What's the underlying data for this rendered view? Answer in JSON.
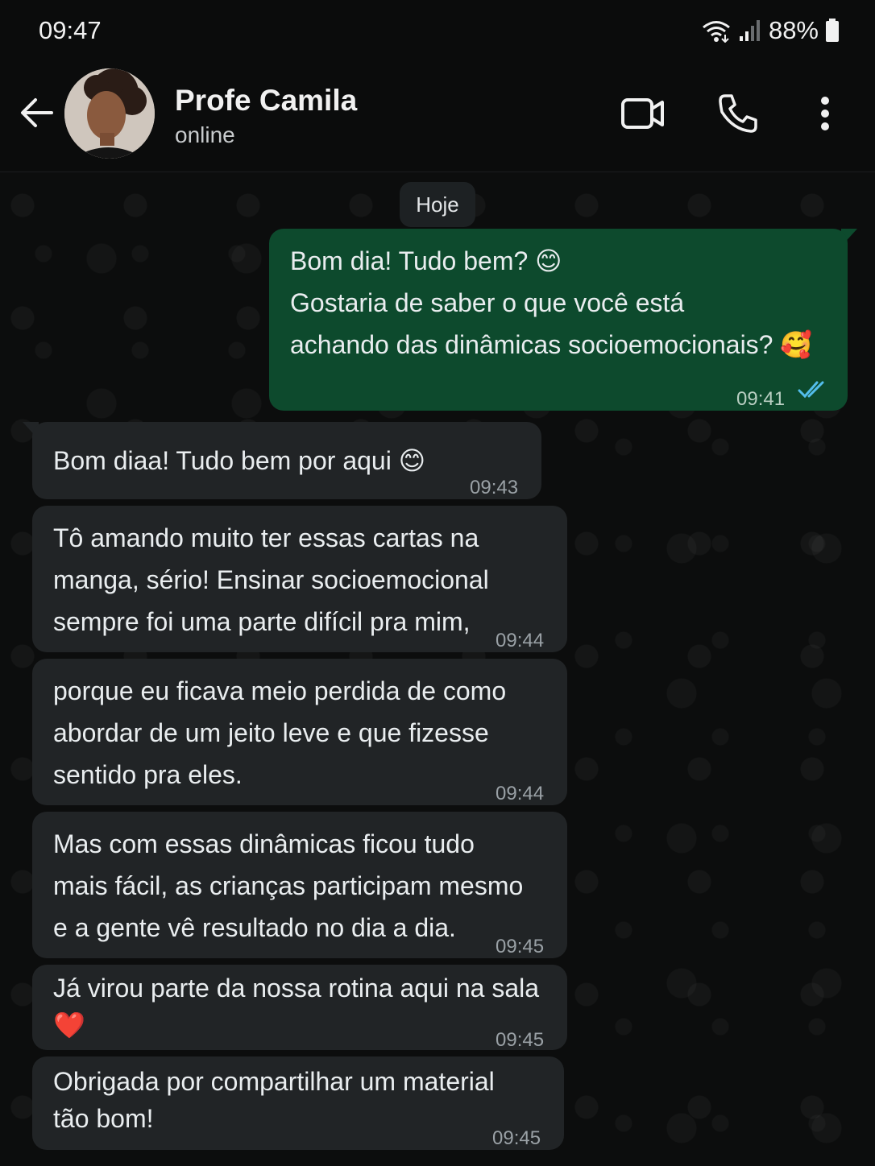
{
  "status_bar": {
    "time": "09:47",
    "battery": "88%"
  },
  "header": {
    "contact_name": "Profe Camila",
    "contact_status": "online"
  },
  "date_chip": "Hoje",
  "messages": [
    {
      "direction": "out",
      "text": "Bom dia! Tudo bem? 😊\nGostaria de saber o que você está\nachando das dinâmicas socioemocionais? 🥰",
      "time": "09:41",
      "read": true
    },
    {
      "direction": "in",
      "text": "Bom diaa! Tudo bem por aqui 😊",
      "time": "09:43"
    },
    {
      "direction": "in",
      "text": "Tô amando muito ter essas cartas na\nmanga, sério! Ensinar socioemocional\nsempre foi uma parte difícil pra mim,",
      "time": "09:44"
    },
    {
      "direction": "in",
      "text": "porque eu ficava meio perdida de como\nabordar de um jeito leve e que fizesse\nsentido pra eles.",
      "time": "09:44"
    },
    {
      "direction": "in",
      "text": "Mas com essas dinâmicas ficou tudo\nmais fácil, as crianças participam mesmo\ne a gente vê resultado no dia a dia.",
      "time": "09:45"
    },
    {
      "direction": "in",
      "text": "Já virou parte da nossa rotina aqui na sala\n❤️",
      "time": "09:45"
    },
    {
      "direction": "in",
      "text": "Obrigada por compartilhar um material\ntão bom!",
      "time": "09:45"
    }
  ],
  "colors": {
    "outgoing_bubble": "#0d4a2d",
    "incoming_bubble": "#212426",
    "read_ticks": "#53bdeb"
  }
}
